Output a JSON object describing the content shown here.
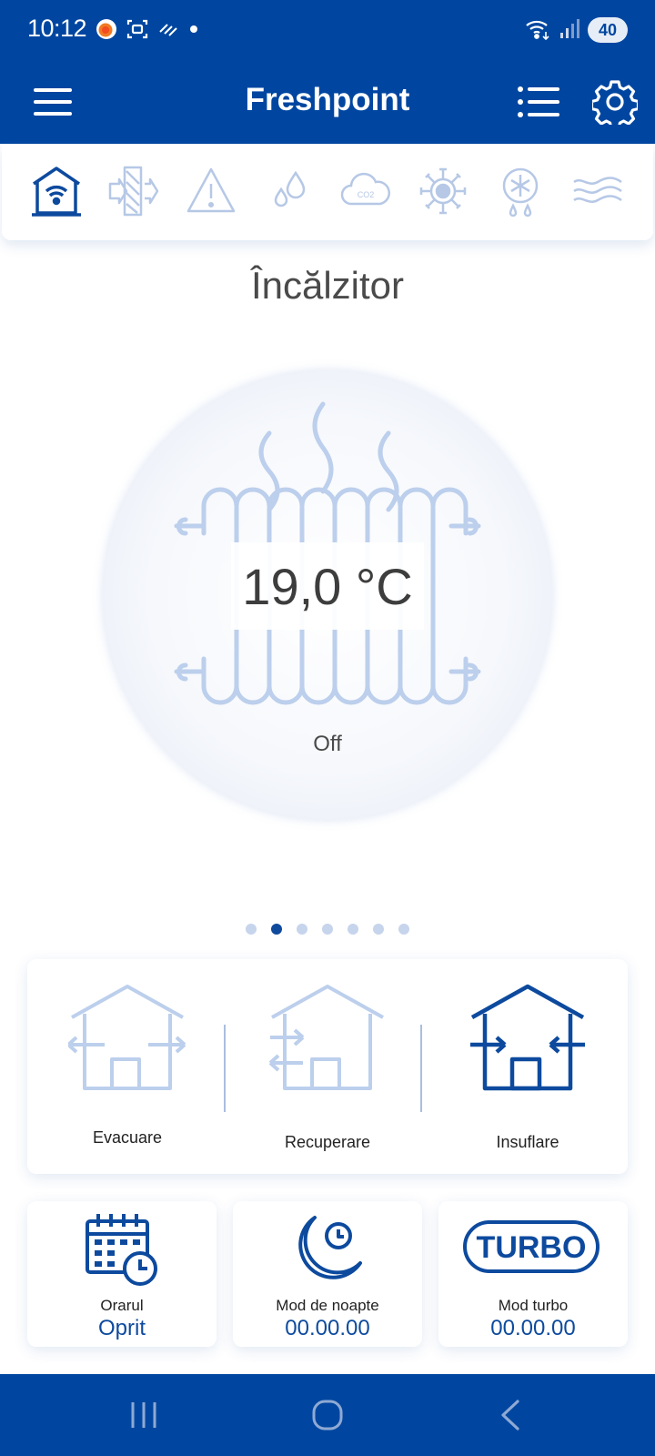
{
  "status_bar": {
    "time": "10:12",
    "battery": "40",
    "icons_left": [
      "app-notification-icon",
      "screenshot-icon",
      "data-sync-icon",
      "dot-icon"
    ],
    "icons_right": [
      "wifi-icon",
      "signal-icon",
      "battery-icon"
    ]
  },
  "app_bar": {
    "title": "Freshpoint",
    "icons": [
      "menu-icon",
      "list-icon",
      "settings-icon"
    ]
  },
  "category_tabs": [
    {
      "icon": "home-wifi-icon",
      "active": true
    },
    {
      "icon": "filter-icon",
      "active": false
    },
    {
      "icon": "warning-icon",
      "active": false
    },
    {
      "icon": "humidity-icon",
      "active": false
    },
    {
      "icon": "co2-cloud-icon",
      "active": false
    },
    {
      "icon": "virus-icon",
      "active": false
    },
    {
      "icon": "frost-drop-icon",
      "active": false
    },
    {
      "icon": "air-waves-icon",
      "active": false
    }
  ],
  "heater": {
    "title": "Încălzitor",
    "temperature": "19,0 °C",
    "status": "Off",
    "icon": "radiator-icon"
  },
  "pager": {
    "count": 7,
    "active_index": 1
  },
  "ventilation_modes": [
    {
      "label": "Evacuare",
      "icon": "house-exhaust-icon",
      "active": false
    },
    {
      "label": "Recuperare",
      "icon": "house-recovery-icon",
      "active": false
    },
    {
      "label": "Insuflare",
      "icon": "house-supply-icon",
      "active": true
    }
  ],
  "tiles": [
    {
      "label": "Orarul",
      "value": "Oprit",
      "icon": "calendar-clock-icon"
    },
    {
      "label": "Mod de noapte",
      "value": "00.00.00",
      "icon": "moon-clock-icon"
    },
    {
      "label": "Mod turbo",
      "value": "00.00.00",
      "icon": "turbo-icon",
      "icon_text": "TURBO"
    }
  ],
  "nav_bar": [
    "recent-apps-icon",
    "home-icon",
    "back-icon"
  ],
  "colors": {
    "primary": "#0046a0",
    "icon_active": "#0d4a9e",
    "icon_inactive": "#b6c8e6",
    "value_text": "#0d4a9e"
  }
}
